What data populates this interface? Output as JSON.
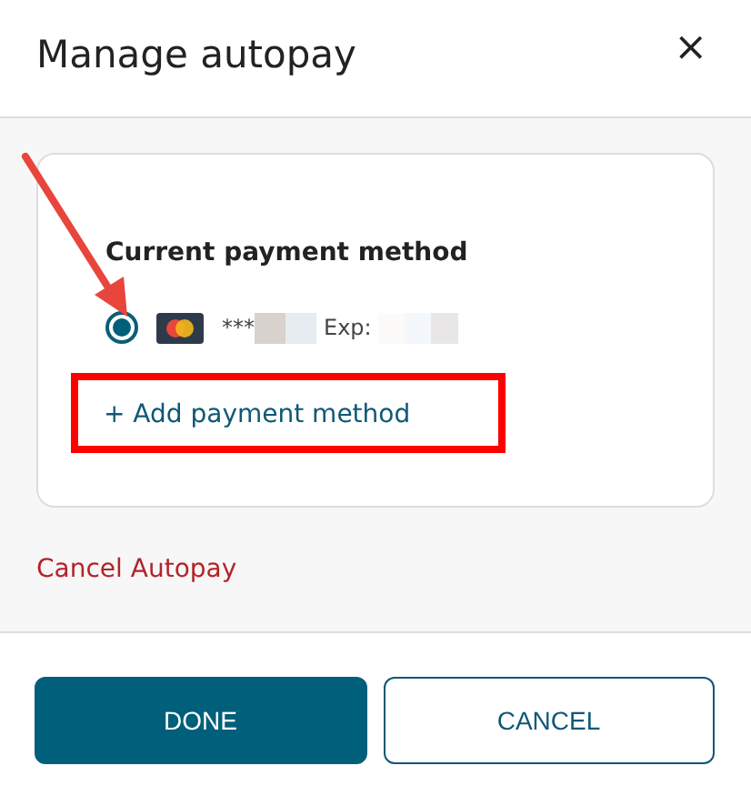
{
  "dialog": {
    "title": "Manage autopay",
    "close": "×"
  },
  "payment_section": {
    "heading": "Current payment method",
    "methods": [
      {
        "masked_number": "***",
        "expiry_label": "Exp:",
        "selected": true
      }
    ],
    "add_link": "+ Add payment method"
  },
  "cancel_link": "Cancel Autopay",
  "buttons": [
    {
      "label": "DONE",
      "kind": "primary"
    },
    {
      "label": "CANCEL",
      "kind": "secondary"
    }
  ]
}
